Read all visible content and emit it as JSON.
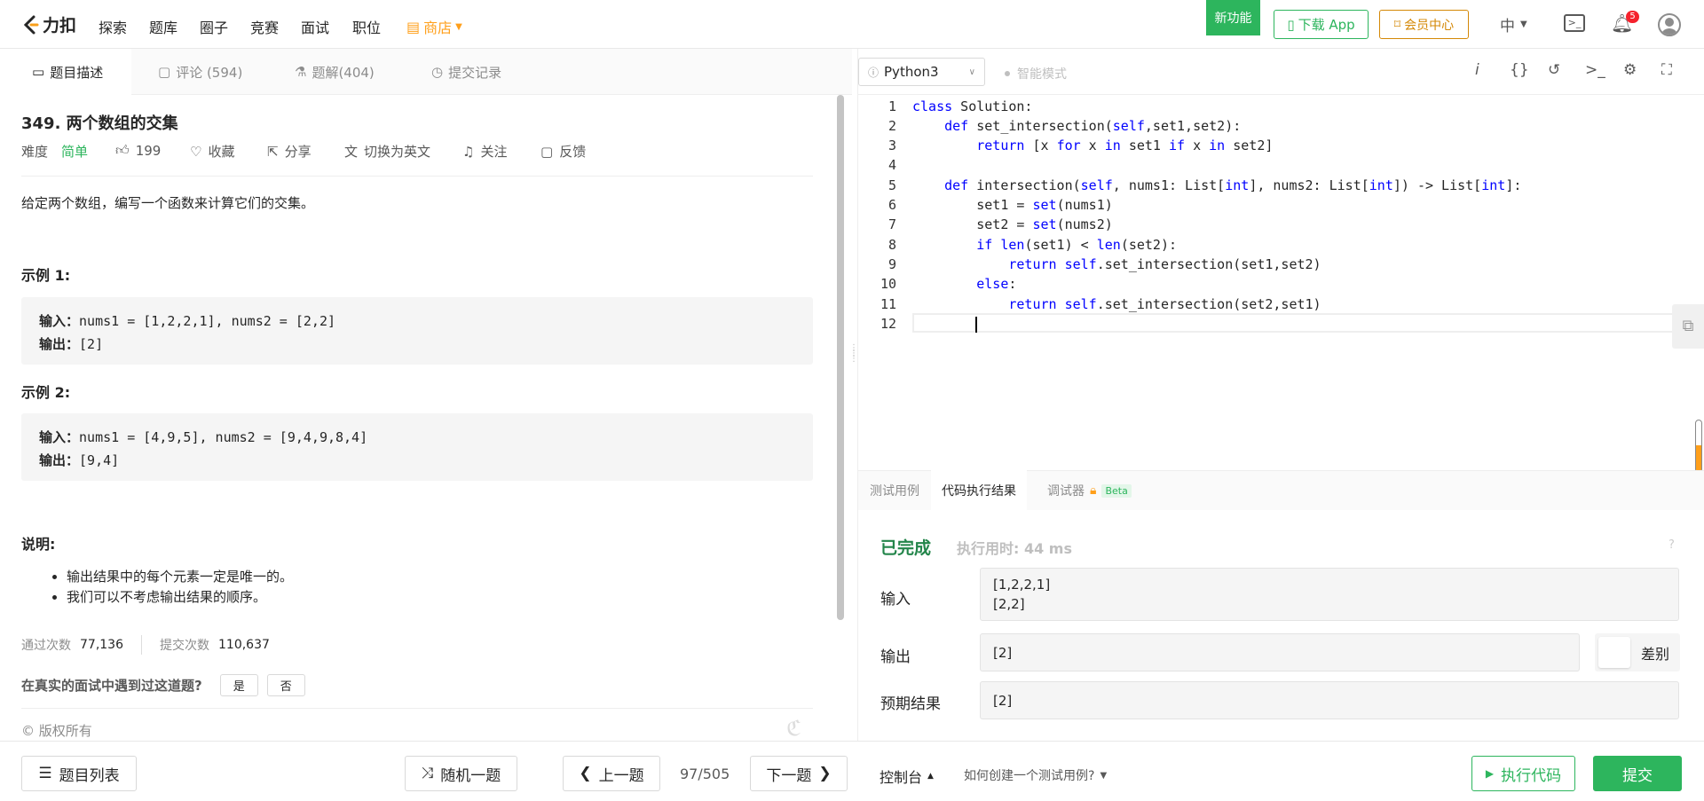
{
  "nav": {
    "logo_text": "力扣",
    "links": [
      "探索",
      "题库",
      "圈子",
      "竞赛",
      "面试",
      "职位"
    ],
    "store": "商店",
    "new_feature": "新功能",
    "download_app": "下载 App",
    "member_center": "会员中心",
    "lang": "中",
    "notification_count": "5"
  },
  "tabs": [
    {
      "label": "题目描述"
    },
    {
      "label": "评论 (594)"
    },
    {
      "label": "题解(404)"
    },
    {
      "label": "提交记录"
    }
  ],
  "problem": {
    "title": "349. 两个数组的交集",
    "difficulty_label": "难度",
    "difficulty": "简单",
    "likes": "199",
    "favorite": "收藏",
    "share": "分享",
    "switch_en": "切换为英文",
    "follow": "关注",
    "feedback": "反馈",
    "description": "给定两个数组，编写一个函数来计算它们的交集。",
    "example1_title": "示例 1:",
    "example1_input_label": "输入：",
    "example1_input": "nums1 = [1,2,2,1], nums2 = [2,2]",
    "example1_output_label": "输出：",
    "example1_output": "[2]",
    "example2_title": "示例 2:",
    "example2_input_label": "输入：",
    "example2_input": "nums1 = [4,9,5], nums2 = [9,4,9,8,4]",
    "example2_output_label": "输出：",
    "example2_output": "[9,4]",
    "notes_title": "说明:",
    "notes": [
      "输出结果中的每个元素一定是唯一的。",
      "我们可以不考虑输出结果的顺序。"
    ],
    "passed_label": "通过次数",
    "passed": "77,136",
    "submitted_label": "提交次数",
    "submitted": "110,637",
    "interview_q": "在真实的面试中遇到过这道题?",
    "yes": "是",
    "no": "否",
    "copyright": "© 版权所有"
  },
  "editor": {
    "language": "Python3",
    "smart_mode": "智能模式",
    "code_lines": [
      "class Solution:",
      "    def set_intersection(self,set1,set2):",
      "        return [x for x in set1 if x in set2]",
      "",
      "    def intersection(self, nums1: List[int], nums2: List[int]) -> List[int]:",
      "        set1 = set(nums1)",
      "        set2 = set(nums2)",
      "        if len(set1) < len(set2):",
      "            return self.set_intersection(set1,set2)",
      "        else:",
      "            return self.set_intersection(set2,set1)",
      ""
    ],
    "line_numbers": [
      "1",
      "2",
      "3",
      "4",
      "5",
      "6",
      "7",
      "8",
      "9",
      "10",
      "11",
      "12"
    ]
  },
  "result": {
    "tabs": [
      "测试用例",
      "代码执行结果",
      "调试器"
    ],
    "beta": "Beta",
    "status": "已完成",
    "runtime": "执行用时: 44 ms",
    "input_label": "输入",
    "input_lines": [
      "[1,2,2,1]",
      "[2,2]"
    ],
    "output_label": "输出",
    "output": "[2]",
    "diff": "差别",
    "expected_label": "预期结果",
    "expected": "[2]"
  },
  "bottom": {
    "problem_list": "题目列表",
    "random": "随机一题",
    "prev": "上一题",
    "page": "97/505",
    "next": "下一题",
    "console": "控制台",
    "how_create": "如何创建一个测试用例?",
    "run": "执行代码",
    "submit": "提交"
  },
  "colors": {
    "green": "#2db55d",
    "orange": "#ff9f1a",
    "dark_green": "#23854a",
    "accent": "#007aff"
  }
}
